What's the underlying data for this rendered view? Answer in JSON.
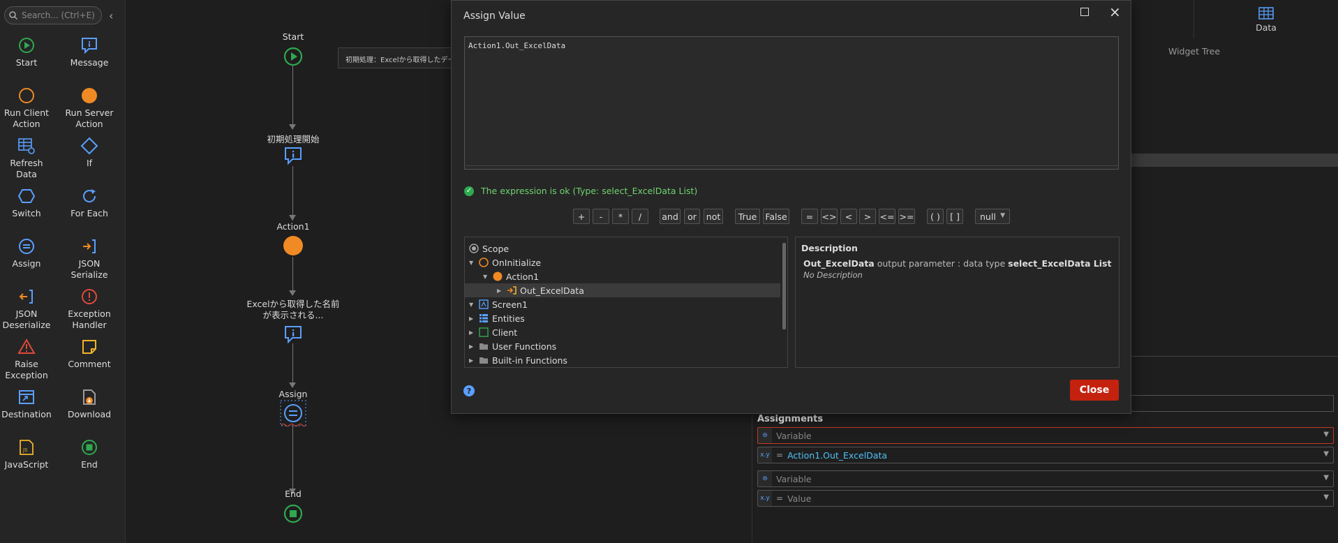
{
  "toolbox": {
    "search_placeholder": "Search... (Ctrl+E)",
    "tools": [
      {
        "label": "Start"
      },
      {
        "label": "Message"
      },
      {
        "label": "Run Client Action"
      },
      {
        "label": "Run Server Action"
      },
      {
        "label": "Refresh Data"
      },
      {
        "label": "If"
      },
      {
        "label": "Switch"
      },
      {
        "label": "For Each"
      },
      {
        "label": "Assign"
      },
      {
        "label": "JSON Serialize"
      },
      {
        "label": "JSON Deserialize"
      },
      {
        "label": "Exception Handler"
      },
      {
        "label": "Raise Exception"
      },
      {
        "label": "Comment"
      },
      {
        "label": "Destination"
      },
      {
        "label": "Download"
      },
      {
        "label": "JavaScript"
      },
      {
        "label": "End"
      }
    ]
  },
  "flow": {
    "nodes": [
      {
        "label": "Start"
      },
      {
        "label": "初期処理開始"
      },
      {
        "label": "Action1"
      },
      {
        "label": "Excelから取得した名前が表示される..."
      },
      {
        "label": "Assign"
      },
      {
        "label": "End"
      }
    ],
    "comment": "初期処理：Excelから取得したデー"
  },
  "right_panel": {
    "data_tab": "Data",
    "widget_tree": "Widget Tree",
    "assignments_title": "Assignments",
    "assignments": [
      {
        "variable": "Variable",
        "value": "Action1.Out_ExcelData"
      },
      {
        "variable": "Variable",
        "value": "Value"
      }
    ]
  },
  "dialog": {
    "title": "Assign Value",
    "expression": "Action1.Out_ExcelData",
    "status": "The expression is ok (Type: select_ExcelData List)",
    "operators": [
      "+",
      "-",
      "*",
      "/",
      "and",
      "or",
      "not",
      "True",
      "False",
      "=",
      "<>",
      "<",
      ">",
      "<=",
      ">=",
      "( )",
      "[ ]",
      "null"
    ],
    "tree": [
      {
        "label": "Scope"
      },
      {
        "label": "OnInitialize"
      },
      {
        "label": "Action1"
      },
      {
        "label": "Out_ExcelData"
      },
      {
        "label": "Screen1"
      },
      {
        "label": "Entities"
      },
      {
        "label": "Client"
      },
      {
        "label": "User Functions"
      },
      {
        "label": "Built-in Functions"
      }
    ],
    "description": {
      "title": "Description",
      "name": "Out_ExcelData",
      "text": "output parameter : data type",
      "type": "select_ExcelData List",
      "detail": "No Description"
    },
    "close_label": "Close"
  },
  "colors": {
    "accent": "#5aa0ff",
    "start_green": "#2fa94f",
    "action_orange": "#f08a24",
    "close_red": "#c4220f",
    "error_red": "#c0392b"
  }
}
